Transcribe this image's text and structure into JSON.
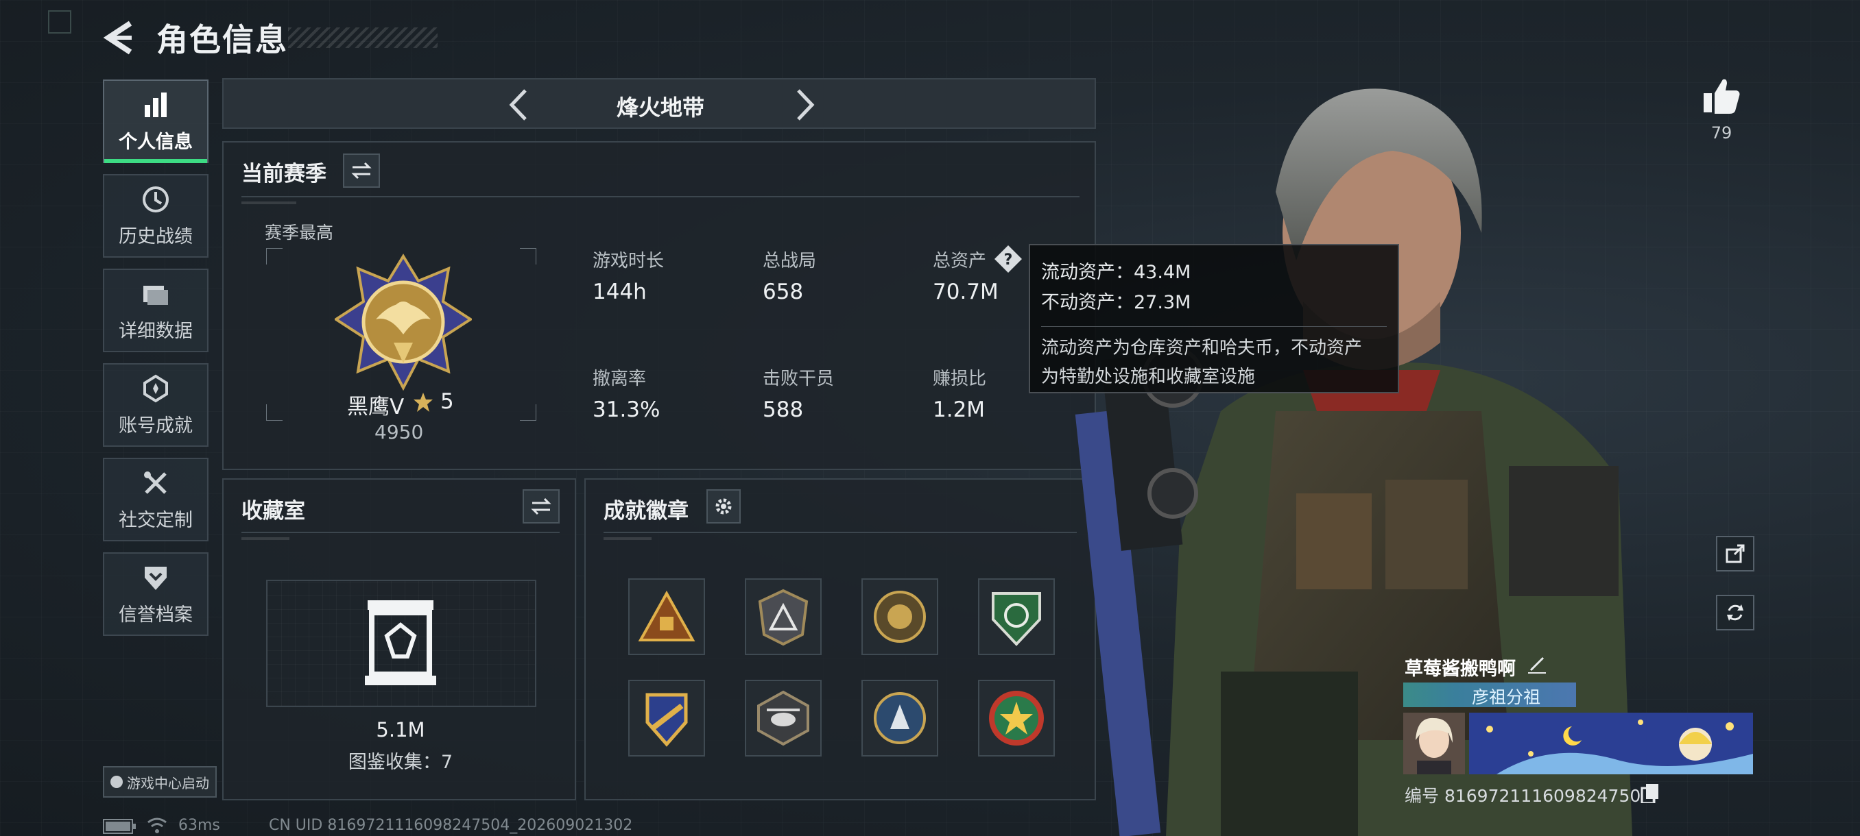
{
  "header": {
    "title": "角色信息"
  },
  "nav": {
    "items": [
      {
        "label": "个人信息",
        "icon": "bar-chart-icon",
        "active": true
      },
      {
        "label": "历史战绩",
        "icon": "history-clock-icon"
      },
      {
        "label": "详细数据",
        "icon": "folder-icon"
      },
      {
        "label": "账号成就",
        "icon": "achievement-icon"
      },
      {
        "label": "社交定制",
        "icon": "tools-icon"
      },
      {
        "label": "信誉档案",
        "icon": "shield-down-icon"
      }
    ]
  },
  "mode": {
    "name": "烽火地带"
  },
  "season": {
    "title": "当前赛季",
    "best_label": "赛季最高",
    "rank_name": "黑鹰Ⅴ",
    "rank_stars": "5",
    "rank_score": "4950",
    "stats": [
      {
        "label": "游戏时长",
        "value": "144h"
      },
      {
        "label": "总战局",
        "value": "658"
      },
      {
        "label": "总资产",
        "value": "70.7M"
      },
      {
        "label": "撤离率",
        "value": "31.3%"
      },
      {
        "label": "击败干员",
        "value": "588"
      },
      {
        "label": "赚损比",
        "value": "1.2M"
      }
    ]
  },
  "tooltip": {
    "liquid": "流动资产：43.4M",
    "fixed": "不动资产：27.3M",
    "desc_line1": "流动资产为仓库资产和哈夫币，不动资产",
    "desc_line2": "为特勤处设施和收藏室设施"
  },
  "collection": {
    "title": "收藏室",
    "value": "5.1M",
    "count_text": "图鉴收集：7"
  },
  "achievements": {
    "title": "成就徽章",
    "badges": [
      "triangle-badge-icon",
      "pyramid-badge-icon",
      "lion-badge-icon",
      "green-shield-badge-icon",
      "wings-badge-icon",
      "helicopter-badge-icon",
      "wolf-badge-icon",
      "star-medal-badge-icon"
    ]
  },
  "profile": {
    "likes": "79",
    "name": "草莓酱搬鸭啊",
    "tag": "彦祖分祖",
    "id_text": "编号 816972111609824750 4"
  },
  "footer": {
    "game_center": "游戏中心启动",
    "ping": "63ms",
    "uid": "CN UID 8169721116098247504_202609021302"
  }
}
